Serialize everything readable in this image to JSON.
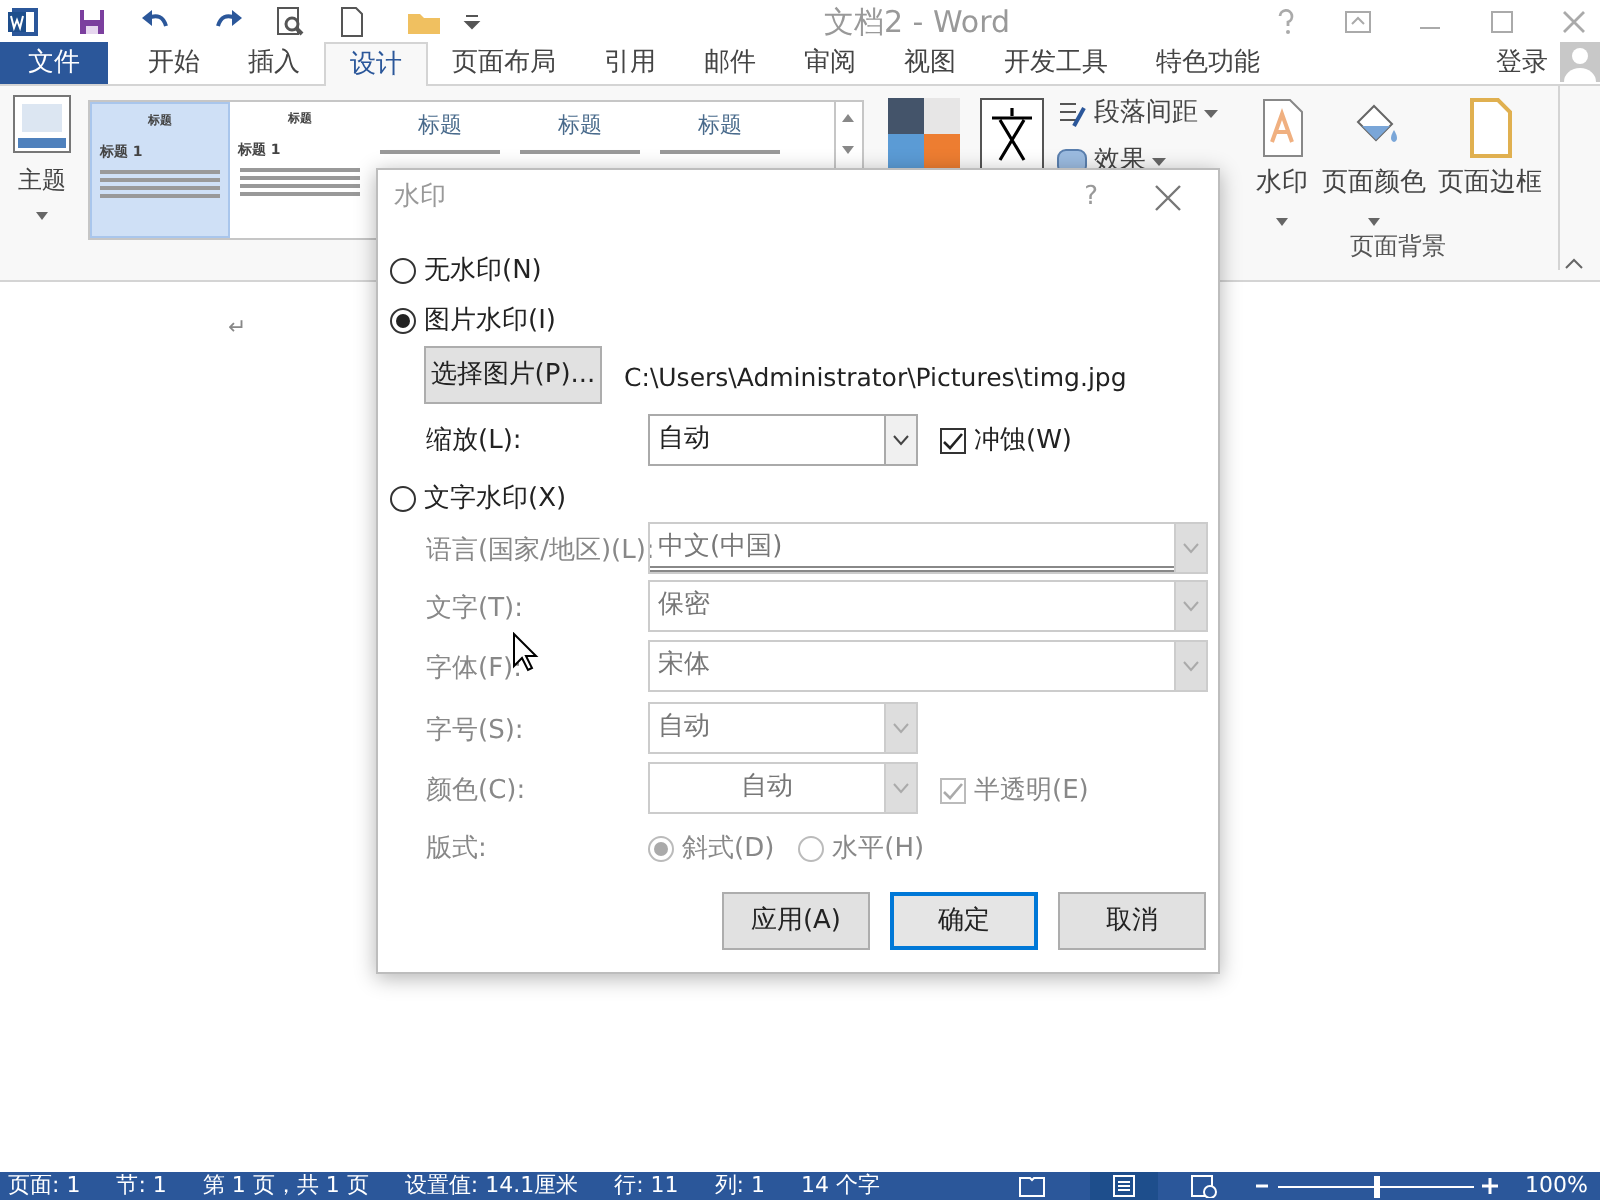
{
  "window": {
    "title": "文档2 - Word"
  },
  "tabs": [
    {
      "label": "文件",
      "kind": "file",
      "selected": false
    },
    {
      "label": "开始",
      "selected": false
    },
    {
      "label": "插入",
      "selected": false
    },
    {
      "label": "设计",
      "selected": true
    },
    {
      "label": "页面布局",
      "selected": false
    },
    {
      "label": "引用",
      "selected": false
    },
    {
      "label": "邮件",
      "selected": false
    },
    {
      "label": "审阅",
      "selected": false
    },
    {
      "label": "视图",
      "selected": false
    },
    {
      "label": "开发工具",
      "selected": false
    },
    {
      "label": "特色功能",
      "selected": false
    }
  ],
  "account": {
    "label": "登录"
  },
  "ribbon": {
    "theme_button": "主题",
    "gallery": [
      {
        "title": "标题",
        "heading": "标题 1",
        "selected": true
      },
      {
        "title": "标题",
        "heading": "标题 1",
        "selected": false
      },
      {
        "title": "标题",
        "selected": false
      },
      {
        "title": "标题",
        "selected": false
      },
      {
        "title": "标题",
        "selected": false
      }
    ],
    "paragraph_spacing": "段落间距",
    "effects": "效果",
    "watermark": "水印",
    "page_color": "页面颜色",
    "page_borders": "页面边框",
    "group_label": "页面背景"
  },
  "document": {
    "paragraph_mark": "↵"
  },
  "dialog": {
    "title": "水印",
    "help": "?",
    "options": [
      {
        "label": "无水印(N)",
        "selected": false
      },
      {
        "label": "图片水印(I)",
        "selected": true
      },
      {
        "label": "文字水印(X)",
        "selected": false
      }
    ],
    "select_picture_button": "选择图片(P)...",
    "picture_path": "C:\\Users\\Administrator\\Pictures\\timg.jpg",
    "scale": {
      "label": "缩放(L):",
      "value": "自动"
    },
    "washout": {
      "label": "冲蚀(W)",
      "checked": true
    },
    "text_fields": [
      {
        "label": "语言(国家/地区)(L):",
        "value": "中文(中国)",
        "kind": "wide",
        "disabled": true
      },
      {
        "label": "文字(T):",
        "value": "保密",
        "kind": "wide",
        "disabled": true
      },
      {
        "label": "字体(F):",
        "value": "宋体",
        "kind": "wide",
        "disabled": true
      },
      {
        "label": "字号(S):",
        "value": "自动",
        "kind": "narrow",
        "disabled": true
      },
      {
        "label": "颜色(C):",
        "value": "自动",
        "kind": "narrow",
        "disabled": true
      }
    ],
    "semitransparent": {
      "label": "半透明(E)",
      "checked": true,
      "disabled": true
    },
    "layout": {
      "label": "版式:",
      "options": [
        {
          "label": "斜式(D)",
          "selected": true
        },
        {
          "label": "水平(H)",
          "selected": false
        }
      ]
    },
    "buttons": [
      {
        "label": "应用(A)",
        "default": false
      },
      {
        "label": "确定",
        "default": true
      },
      {
        "label": "取消",
        "default": false
      }
    ]
  },
  "status_bar": {
    "items": [
      "页面: 1",
      "节: 1",
      "第 1 页，共 1 页",
      "设置值: 14.1厘米",
      "行: 11",
      "列: 1",
      "14 个字"
    ],
    "zoom": "100%",
    "level": 0.5
  }
}
